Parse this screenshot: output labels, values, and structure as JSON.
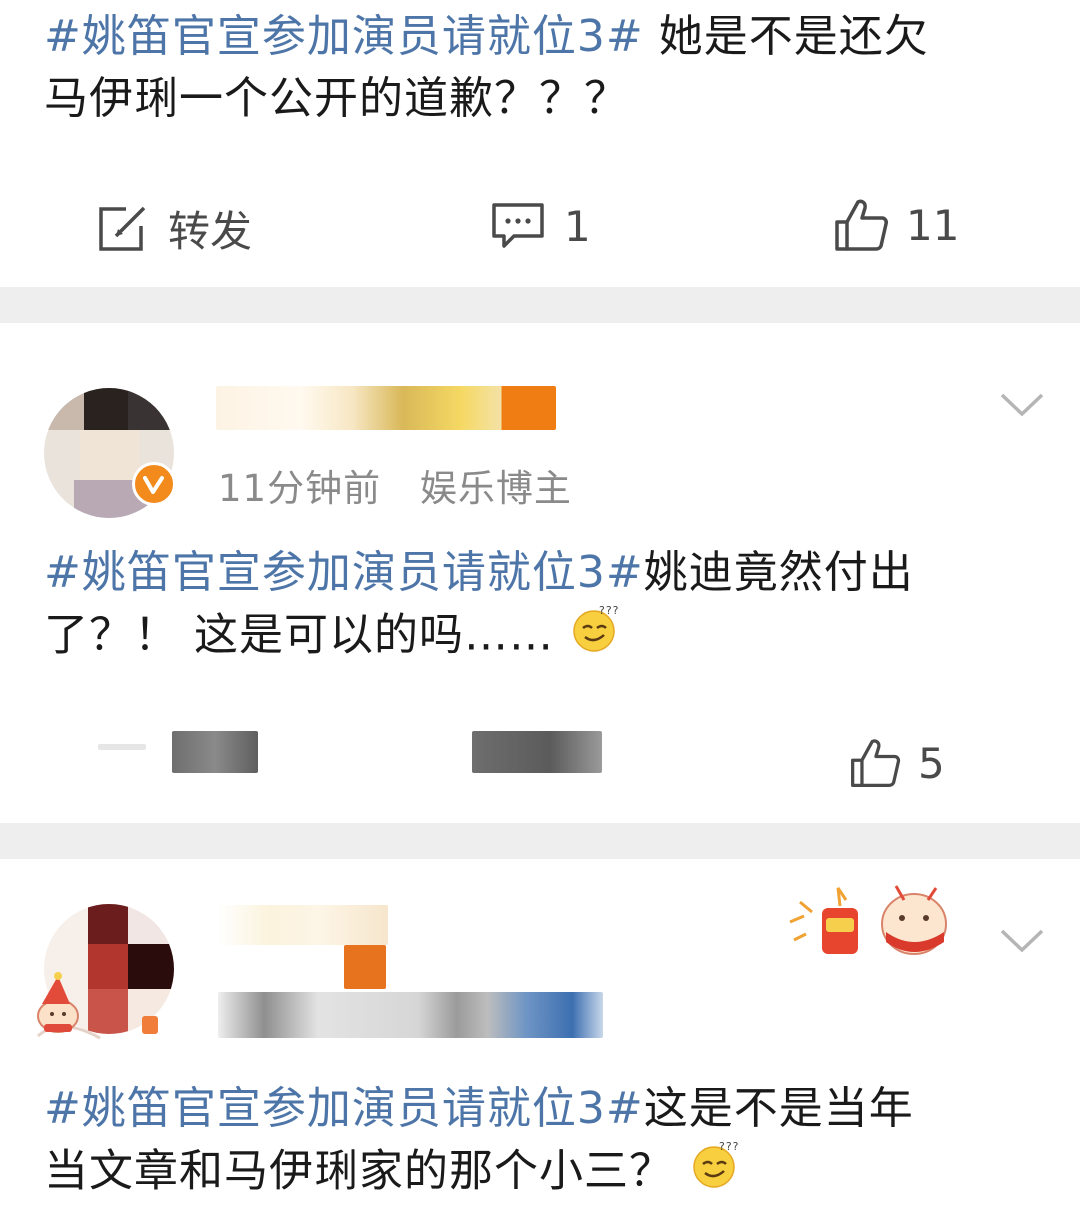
{
  "post1": {
    "topic": "#姚笛官宣参加演员请就位3#",
    "text_line1_tail": " 她是不是还欠",
    "text_line2": "马伊琍一个公开的道歉？？？",
    "repost_label": "转发",
    "comment_count": "1",
    "like_count": "11"
  },
  "post2": {
    "time": "11分钟前",
    "tag": "娱乐博主",
    "topic": "#姚笛官宣参加演员请就位3#",
    "text_line1_tail": "姚迪竟然付出",
    "text_line2": "了？！ 这是可以的吗……",
    "like_count": "5"
  },
  "post3": {
    "topic": "#姚笛官宣参加演员请就位3#",
    "text_line1_tail": "这是不是当年",
    "text_line2": "当文章和马伊琍家的那个小三？"
  },
  "colors": {
    "topic": "#4d75a8",
    "divider": "#eeeeee",
    "verified_badge": "#f28a1c"
  }
}
